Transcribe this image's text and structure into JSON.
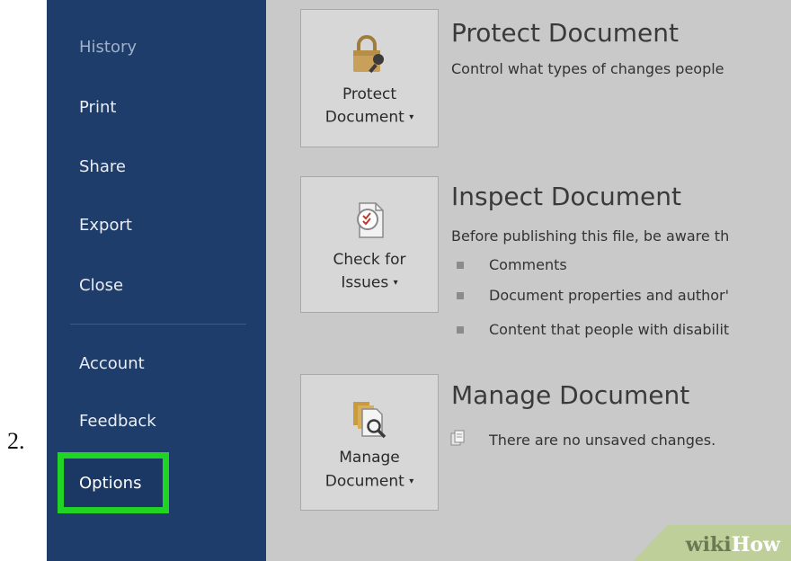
{
  "step": {
    "number": "2."
  },
  "sidebar": {
    "items": [
      {
        "label": "History"
      },
      {
        "label": "Print"
      },
      {
        "label": "Share"
      },
      {
        "label": "Export"
      },
      {
        "label": "Close"
      },
      {
        "label": "Account"
      },
      {
        "label": "Feedback"
      },
      {
        "label": "Options"
      }
    ],
    "highlight_color": "#21d324",
    "background_color": "#1f3d6b"
  },
  "sections": {
    "protect": {
      "button_line1": "Protect",
      "button_line2": "Document",
      "button_caret": "▾",
      "title": "Protect Document",
      "description": "Control what types of changes people",
      "icon": "lock-icon"
    },
    "inspect": {
      "button_line1": "Check for",
      "button_line2": "Issues",
      "button_caret": "▾",
      "title": "Inspect Document",
      "description": "Before publishing this file, be aware th",
      "bullets": [
        "Comments",
        "Document properties and author'",
        "Content that people with disabilit"
      ],
      "icon": "inspect-document-icon"
    },
    "manage": {
      "button_line1": "Manage",
      "button_line2": "Document",
      "button_caret": "▾",
      "title": "Manage Document",
      "status": "There are no unsaved changes.",
      "icon": "manage-document-icon"
    }
  },
  "watermark": {
    "part1": "wiki",
    "part2": "How"
  }
}
